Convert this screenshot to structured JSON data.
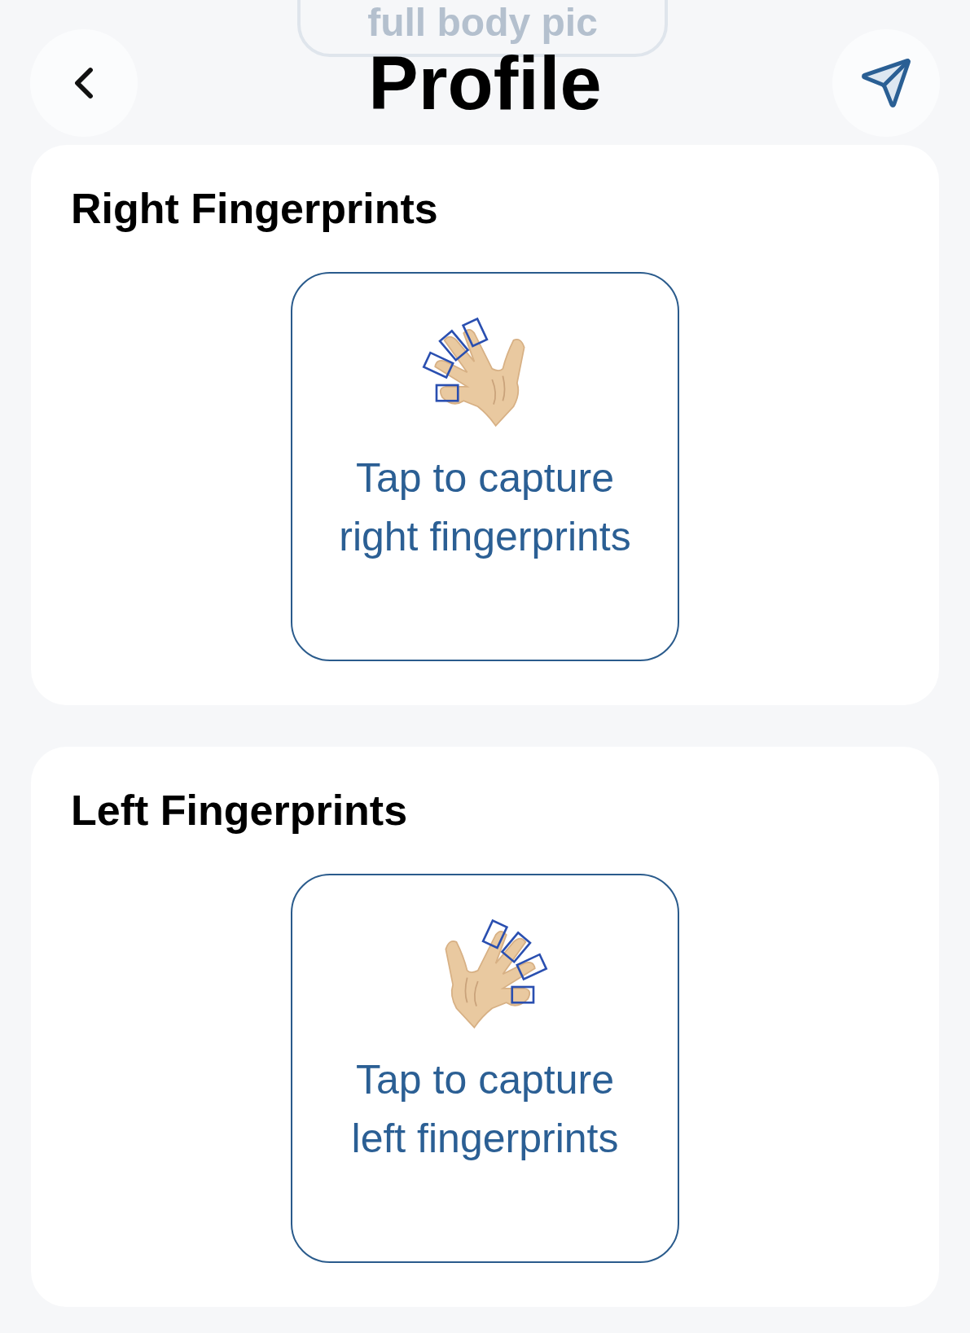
{
  "background_button": {
    "label": "full body pic"
  },
  "header": {
    "title": "Profile"
  },
  "sections": [
    {
      "title": "Right Fingerprints",
      "kind": "right",
      "capture_text": "Tap to capture right fingerprints"
    },
    {
      "title": "Left Fingerprints",
      "kind": "left",
      "capture_text": "Tap to capture left fingerprints"
    }
  ]
}
